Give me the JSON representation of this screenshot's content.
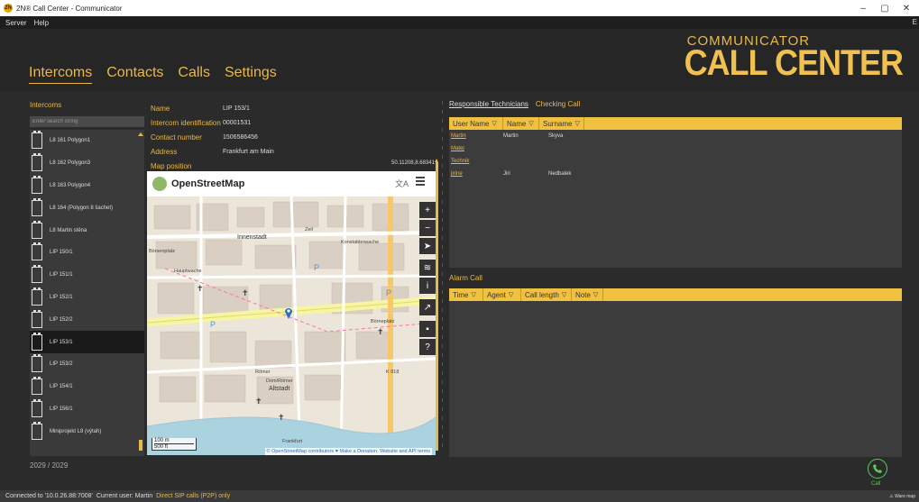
{
  "window": {
    "title": "2N® Call Center - Communicator",
    "controls": [
      "–",
      "▢",
      "✕"
    ]
  },
  "menubar": {
    "items": [
      "Server",
      "Help"
    ],
    "edge": "E"
  },
  "nav": {
    "tabs": [
      "Intercoms",
      "Contacts",
      "Calls",
      "Settings"
    ],
    "active": "Intercoms"
  },
  "brand": {
    "top": "COMMUNICATOR",
    "bottom": "CALL CENTER"
  },
  "intercoms": {
    "label": "Intercoms",
    "search_placeholder": "Enter search string",
    "items": [
      "L8 161 Polygon1",
      "L8 162 Polygon3",
      "L8 163 Polygon4",
      "L8 164 (Polygon 8 šachet)",
      "L8 Martin stěna",
      "LIP 150/1",
      "LIP 151/1",
      "LIP 152/1",
      "LIP 152/2",
      "LIP 153/1",
      "LIP 153/2",
      "LIP 154/1",
      "LIP 156/1",
      "Miniprojekt L8 (výtah)"
    ],
    "selected_index": 9,
    "counter": "2029 / 2029"
  },
  "details": {
    "name_label": "Name",
    "name_value": "LIP 153/1",
    "id_label": "Intercom identification",
    "id_value": "00001531",
    "contact_label": "Contact number",
    "contact_value": "1506586456",
    "address_label": "Address",
    "address_value": "Frankfurt am Main",
    "map_label": "Map position",
    "map_value": "50.11208,8.68341"
  },
  "map": {
    "title": "OpenStreetMap",
    "scale_top": "100 m",
    "scale_bottom": "500 ft",
    "attribution": "© OpenStreetMap contributors ♥ Make a Donation. Website and API terms",
    "place_labels": [
      "Innenstadt",
      "Altstadt",
      "Konstablerwache",
      "Hauptwache",
      "Römer",
      "Dom/Römer",
      "Zeil",
      "Börneplatz",
      "Frankfurt",
      "K 818",
      "Börsenplatz"
    ]
  },
  "right": {
    "tabs": [
      "Responsible Technicians",
      "Checking Call"
    ],
    "tech_headers": [
      "User Name",
      "Name",
      "Surname"
    ],
    "technicians": [
      {
        "user": "Martin",
        "name": "Martin",
        "surname": "Skyva"
      },
      {
        "user": "Matej",
        "name": "",
        "surname": ""
      },
      {
        "user": "Technik",
        "name": "",
        "surname": ""
      },
      {
        "user": "jirine",
        "name": "Jiri",
        "surname": "Nedbalek"
      }
    ],
    "alarm_label": "Alarm Call",
    "alarm_headers": [
      "Time",
      "Agent",
      "Call length",
      "Note"
    ]
  },
  "call": {
    "label": "Call"
  },
  "status": {
    "connection": "Connected to '10.0.26.88:7008'",
    "user": "Current user: Martin",
    "mode": "Direct SIP calls (P2P) only",
    "warning": "⚠ Ware map"
  },
  "colors": {
    "accent": "#e8b84a",
    "call": "#5acb5a"
  }
}
